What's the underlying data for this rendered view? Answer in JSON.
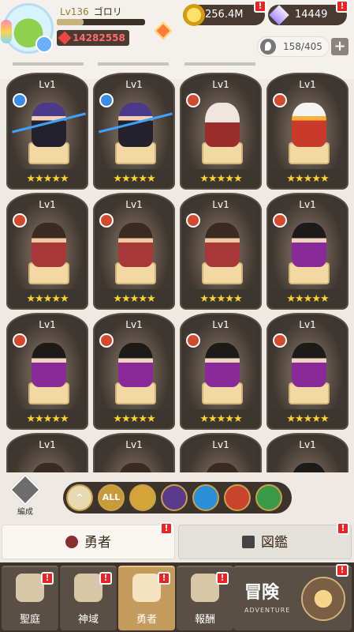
{
  "player": {
    "level": "Lv136",
    "name": "ゴロリ",
    "power": "14282558",
    "xp_fraction": 0.3
  },
  "resources": {
    "gold": "256.4M",
    "gems": "14449"
  },
  "roster": {
    "count": "158/405"
  },
  "heroes": [
    {
      "level": "Lv1",
      "stars": "★★★★★",
      "attr": "water",
      "sprite": "s1"
    },
    {
      "level": "Lv1",
      "stars": "★★★★★",
      "attr": "water",
      "sprite": "s1"
    },
    {
      "level": "Lv1",
      "stars": "★★★★★",
      "attr": "fire",
      "sprite": "s2"
    },
    {
      "level": "Lv1",
      "stars": "★★★★★",
      "attr": "fire",
      "sprite": "s3"
    },
    {
      "level": "Lv1",
      "stars": "★★★★★",
      "attr": "fire",
      "sprite": "s4"
    },
    {
      "level": "Lv1",
      "stars": "★★★★★",
      "attr": "fire",
      "sprite": "s4"
    },
    {
      "level": "Lv1",
      "stars": "★★★★★",
      "attr": "fire",
      "sprite": "s4"
    },
    {
      "level": "Lv1",
      "stars": "★★★★★",
      "attr": "fire",
      "sprite": "s5"
    },
    {
      "level": "Lv1",
      "stars": "★★★★★",
      "attr": "fire",
      "sprite": "s5"
    },
    {
      "level": "Lv1",
      "stars": "★★★★★",
      "attr": "fire",
      "sprite": "s5"
    },
    {
      "level": "Lv1",
      "stars": "★★★★★",
      "attr": "fire",
      "sprite": "s5"
    },
    {
      "level": "Lv1",
      "stars": "★★★★★",
      "attr": "fire",
      "sprite": "s5"
    },
    {
      "level": "Lv1",
      "stars": "",
      "attr": "",
      "sprite": "s4"
    },
    {
      "level": "Lv1",
      "stars": "",
      "attr": "",
      "sprite": "s4"
    },
    {
      "level": "Lv1",
      "stars": "",
      "attr": "",
      "sprite": "s4"
    },
    {
      "level": "Lv1",
      "stars": "",
      "attr": "",
      "sprite": "s5"
    }
  ],
  "filter": {
    "formation_label": "編成",
    "chips": [
      {
        "label": "^",
        "color": "#e8d9b0"
      },
      {
        "label": "ALL",
        "color": "#c79a3a"
      },
      {
        "label": "",
        "color": "#d2a43a"
      },
      {
        "label": "",
        "color": "#5a3a8a"
      },
      {
        "label": "",
        "color": "#2b8ed8"
      },
      {
        "label": "",
        "color": "#c9442c"
      },
      {
        "label": "",
        "color": "#3a9a4a"
      }
    ]
  },
  "tabs": {
    "heroes": "勇者",
    "encyclopedia": "図鑑"
  },
  "nav": {
    "sanctuary": "聖庭",
    "divine": "神域",
    "heroes": "勇者",
    "rewards": "報酬",
    "adventure_jp": "冒険",
    "adventure_en": "ADVENTURE"
  },
  "alert_mark": "!"
}
